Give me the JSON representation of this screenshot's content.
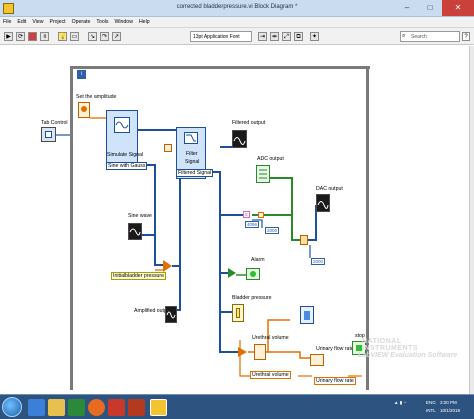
{
  "window": {
    "title": "corrected bladderpressure.vi Block Diagram *",
    "min_label": "–",
    "max_label": "□",
    "close_label": "✕"
  },
  "menu": [
    "File",
    "Edit",
    "View",
    "Project",
    "Operate",
    "Tools",
    "Window",
    "Help"
  ],
  "toolbar": {
    "font_select": "13pt Application Font",
    "search_placeholder": "Search"
  },
  "diagram": {
    "tab_control": "Tab Control",
    "set_amplitude": "Set the amplitude",
    "simulate_signal": "Simulate Signal",
    "sine_with_gauss": "Sine with Gauss",
    "filter": "Filter",
    "signal": "Signal",
    "filtered_signal": "Filtered Signal",
    "filtered_output": "Filtered output",
    "adc_output": "ADC output",
    "dac_output": "DAC output",
    "const_2000a": "2000",
    "const_2000b": "2000",
    "const_4096": "4096",
    "sine_wave": "Sine wave",
    "bladder_string": "Initialbladder pressure",
    "amplified_output": "Amplified output",
    "alarm": "Alarm",
    "bladder_pressure": "Bladder pressure",
    "urethral_volume": "Urethral volume",
    "urethral_volume_2": "Urethral volume",
    "urinary_flow_rate": "Urinary flow rate",
    "urinary_flow_rate_2": "Urinary flow rate",
    "stop": "stop"
  },
  "watermark": {
    "line1": "NATIONAL",
    "line2": "INSTRUMENTS",
    "line3": "LabVIEW Evaluation Software"
  },
  "taskbar": {
    "lang": "ENG",
    "region": "INTL",
    "time": "3:00 PM",
    "date": "10/1/2018"
  }
}
